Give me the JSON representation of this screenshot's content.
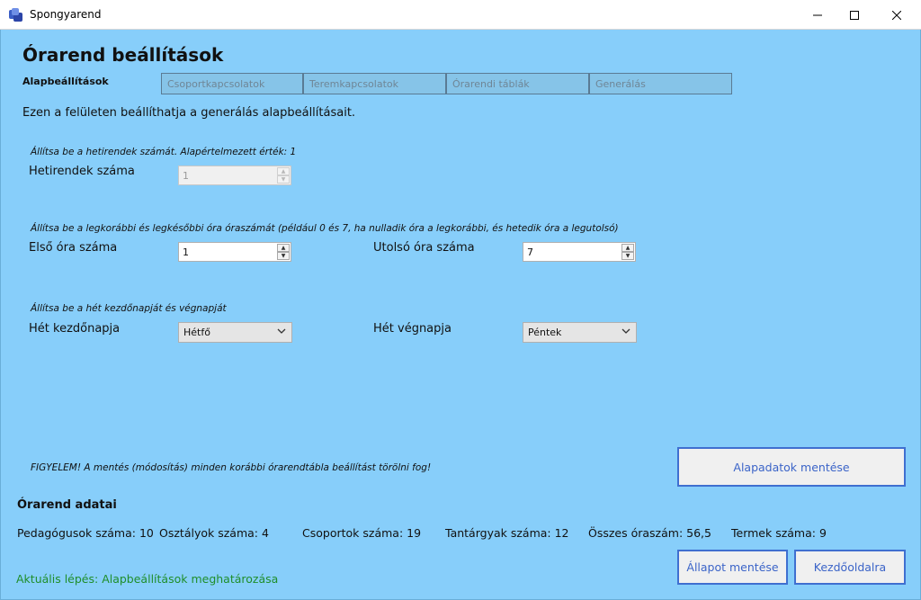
{
  "window": {
    "title": "Spongyarend"
  },
  "page": {
    "title": "Órarend beállítások",
    "active_tab": "Alapbeállítások",
    "tabs": [
      "Csoportkapcsolatok",
      "Teremkapcsolatok",
      "Órarendi táblák",
      "Generálás"
    ],
    "intro": "Ezen a felületen beállíthatja a generálás alapbeállításait."
  },
  "weeks": {
    "hint": "Állítsa be a hetirendek számát. Alapértelmezett érték: 1",
    "label": "Hetirendek száma",
    "value": "1"
  },
  "periods": {
    "hint": "Állítsa be a legkorábbi és legkésőbbi óra óraszámát (például 0 és 7, ha nulladik óra a legkorábbi, és hetedik óra a legutolsó)",
    "first_label": "Első óra száma",
    "first_value": "1",
    "last_label": "Utolsó óra száma",
    "last_value": "7"
  },
  "days": {
    "hint": "Állítsa be a hét kezdőnapját és végnapját",
    "start_label": "Hét kezdőnapja",
    "start_value": "Hétfő",
    "end_label": "Hét végnapja",
    "end_value": "Péntek"
  },
  "warning": "FIGYELEM! A mentés (módosítás) minden korábbi órarendtábla beállítást törölni fog!",
  "buttons": {
    "save_base": "Alapadatok mentése",
    "save_state": "Állapot mentése",
    "home": "Kezdőoldalra"
  },
  "summary": {
    "title": "Órarend adatai",
    "teachers": "Pedagógusok száma: 10",
    "classes": "Osztályok száma: 4",
    "groups": "Csoportok száma: 19",
    "subjects": "Tantárgyak száma: 12",
    "hours": "Összes óraszám: 56,5",
    "rooms": "Termek száma: 9"
  },
  "status": "Aktuális lépés: Alapbeállítások meghatározása",
  "colors": {
    "background": "#87cefa",
    "button_border": "#3f6fd0",
    "status_text": "#1f8e2a"
  },
  "icons": {
    "app": "app-icon",
    "minimize": "minimize-icon",
    "maximize": "maximize-icon",
    "close": "close-icon",
    "dropdown": "chevron-down-icon"
  }
}
